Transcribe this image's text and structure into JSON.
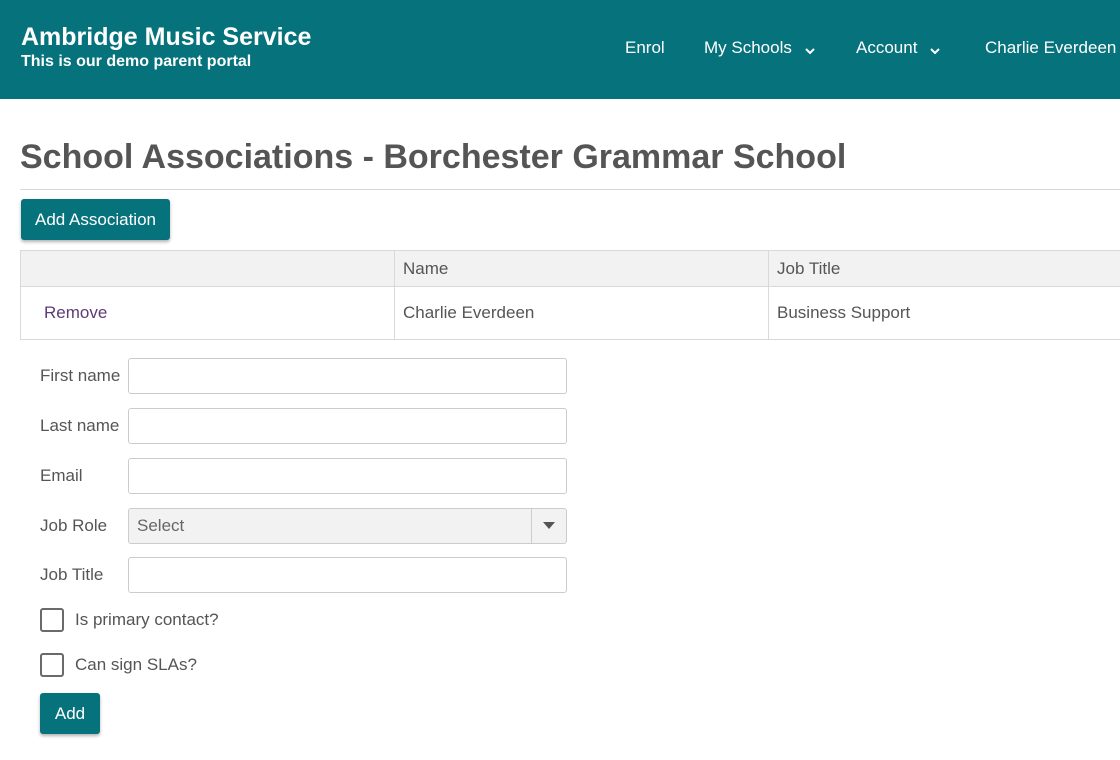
{
  "header": {
    "brand_title": "Ambridge Music Service",
    "brand_subtitle": "This is our demo parent portal",
    "nav": {
      "enrol": "Enrol",
      "my_schools": "My Schools",
      "account": "Account",
      "user": "Charlie Everdeen"
    }
  },
  "page": {
    "title": "School Associations - Borchester Grammar School",
    "add_association_label": "Add Association"
  },
  "table": {
    "columns": [
      "",
      "Name",
      "Job Title"
    ],
    "rows": [
      {
        "action": "Remove",
        "name": "Charlie Everdeen",
        "job_title": "Business Support"
      }
    ]
  },
  "form": {
    "first_name_label": "First name",
    "first_name_value": "",
    "last_name_label": "Last name",
    "last_name_value": "",
    "email_label": "Email",
    "email_value": "",
    "job_role_label": "Job Role",
    "job_role_selected": "Select",
    "job_title_label": "Job Title",
    "job_title_value": "",
    "primary_contact_label": "Is primary contact?",
    "primary_contact_checked": false,
    "can_sign_label": "Can sign SLAs?",
    "can_sign_checked": false,
    "add_label": "Add"
  },
  "colors": {
    "brand": "#06727c",
    "link": "#5e3b75"
  },
  "icons": {
    "nav_dropdown": "chevron-down-icon",
    "select_dropdown": "caret-down-icon"
  }
}
